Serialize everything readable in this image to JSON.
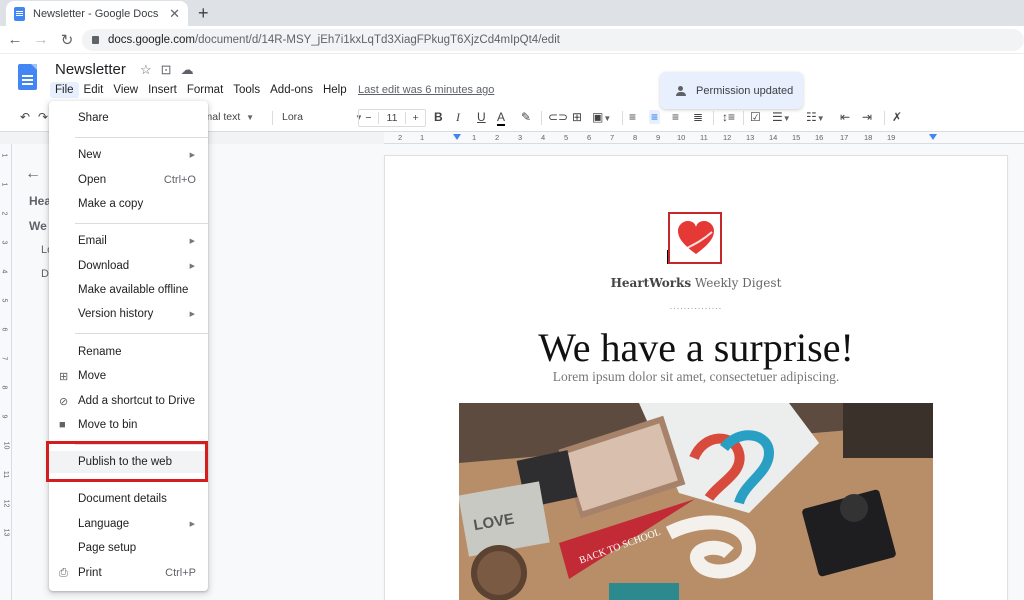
{
  "browser": {
    "tab_title": "Newsletter - Google Docs",
    "url_domain": "docs.google.com",
    "url_path": "/document/d/14R-MSY_jEh7i1kxLqTd3XiagFPkugT6XjzCd4mIpQt4/edit"
  },
  "docs": {
    "title": "Newsletter",
    "menus": [
      "File",
      "Edit",
      "View",
      "Insert",
      "Format",
      "Tools",
      "Add-ons",
      "Help"
    ],
    "last_edit": "Last edit was 6 minutes ago",
    "toast": "Permission updated"
  },
  "toolbar": {
    "style": "rmal text",
    "font": "Lora",
    "font_size": "11",
    "minus": "−",
    "plus": "+"
  },
  "ruler": {
    "h_numbers": [
      "2",
      "1",
      "1",
      "2",
      "3",
      "4",
      "5",
      "6",
      "7",
      "8",
      "9",
      "10",
      "11",
      "12",
      "13",
      "14",
      "15",
      "16",
      "17",
      "18",
      "19"
    ],
    "v_numbers": [
      "1",
      "1",
      "2",
      "3",
      "4",
      "5",
      "6",
      "7",
      "8",
      "9",
      "10",
      "11",
      "12",
      "13"
    ]
  },
  "outline": {
    "items": [
      "Hea",
      "We",
      "Lo",
      "D"
    ]
  },
  "file_menu": {
    "share": "Share",
    "new": "New",
    "open": "Open",
    "open_shortcut": "Ctrl+O",
    "make_copy": "Make a copy",
    "email": "Email",
    "download": "Download",
    "offline": "Make available offline",
    "version_history": "Version history",
    "rename": "Rename",
    "move": "Move",
    "add_shortcut": "Add a shortcut to Drive",
    "move_to_bin": "Move to bin",
    "publish": "Publish to the web",
    "details": "Document details",
    "language": "Language",
    "page_setup": "Page setup",
    "print": "Print",
    "print_shortcut": "Ctrl+P"
  },
  "document": {
    "brand_bold": "HeartWorks",
    "brand_rest": " Weekly Digest",
    "dots": "...............",
    "headline": "We have a surprise!",
    "subline": "Lorem ipsum dolor sit amet, consectetuer adipiscing.",
    "image_alt": "Flat lay of school items: t-shirt, pennant 'BACK TO SCHOOL', camera, book"
  },
  "colors": {
    "accent": "#1a73e8",
    "highlight_box": "#d41d1d",
    "logo_red": "#c62828"
  }
}
